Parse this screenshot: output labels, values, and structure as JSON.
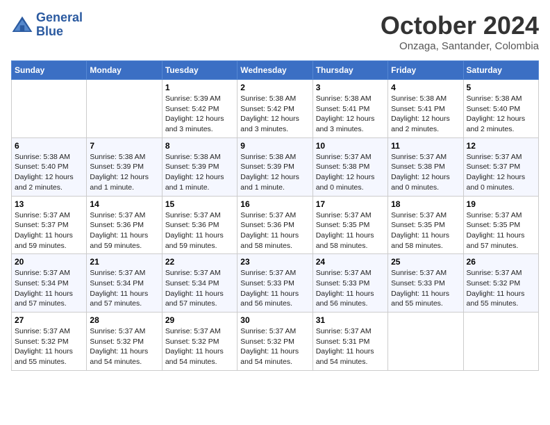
{
  "logo": {
    "line1": "General",
    "line2": "Blue"
  },
  "title": "October 2024",
  "location": "Onzaga, Santander, Colombia",
  "days_header": [
    "Sunday",
    "Monday",
    "Tuesday",
    "Wednesday",
    "Thursday",
    "Friday",
    "Saturday"
  ],
  "weeks": [
    [
      {
        "day": "",
        "info": ""
      },
      {
        "day": "",
        "info": ""
      },
      {
        "day": "1",
        "info": "Sunrise: 5:39 AM\nSunset: 5:42 PM\nDaylight: 12 hours and 3 minutes."
      },
      {
        "day": "2",
        "info": "Sunrise: 5:38 AM\nSunset: 5:42 PM\nDaylight: 12 hours and 3 minutes."
      },
      {
        "day": "3",
        "info": "Sunrise: 5:38 AM\nSunset: 5:41 PM\nDaylight: 12 hours and 3 minutes."
      },
      {
        "day": "4",
        "info": "Sunrise: 5:38 AM\nSunset: 5:41 PM\nDaylight: 12 hours and 2 minutes."
      },
      {
        "day": "5",
        "info": "Sunrise: 5:38 AM\nSunset: 5:40 PM\nDaylight: 12 hours and 2 minutes."
      }
    ],
    [
      {
        "day": "6",
        "info": "Sunrise: 5:38 AM\nSunset: 5:40 PM\nDaylight: 12 hours and 2 minutes."
      },
      {
        "day": "7",
        "info": "Sunrise: 5:38 AM\nSunset: 5:39 PM\nDaylight: 12 hours and 1 minute."
      },
      {
        "day": "8",
        "info": "Sunrise: 5:38 AM\nSunset: 5:39 PM\nDaylight: 12 hours and 1 minute."
      },
      {
        "day": "9",
        "info": "Sunrise: 5:38 AM\nSunset: 5:39 PM\nDaylight: 12 hours and 1 minute."
      },
      {
        "day": "10",
        "info": "Sunrise: 5:37 AM\nSunset: 5:38 PM\nDaylight: 12 hours and 0 minutes."
      },
      {
        "day": "11",
        "info": "Sunrise: 5:37 AM\nSunset: 5:38 PM\nDaylight: 12 hours and 0 minutes."
      },
      {
        "day": "12",
        "info": "Sunrise: 5:37 AM\nSunset: 5:37 PM\nDaylight: 12 hours and 0 minutes."
      }
    ],
    [
      {
        "day": "13",
        "info": "Sunrise: 5:37 AM\nSunset: 5:37 PM\nDaylight: 11 hours and 59 minutes."
      },
      {
        "day": "14",
        "info": "Sunrise: 5:37 AM\nSunset: 5:36 PM\nDaylight: 11 hours and 59 minutes."
      },
      {
        "day": "15",
        "info": "Sunrise: 5:37 AM\nSunset: 5:36 PM\nDaylight: 11 hours and 59 minutes."
      },
      {
        "day": "16",
        "info": "Sunrise: 5:37 AM\nSunset: 5:36 PM\nDaylight: 11 hours and 58 minutes."
      },
      {
        "day": "17",
        "info": "Sunrise: 5:37 AM\nSunset: 5:35 PM\nDaylight: 11 hours and 58 minutes."
      },
      {
        "day": "18",
        "info": "Sunrise: 5:37 AM\nSunset: 5:35 PM\nDaylight: 11 hours and 58 minutes."
      },
      {
        "day": "19",
        "info": "Sunrise: 5:37 AM\nSunset: 5:35 PM\nDaylight: 11 hours and 57 minutes."
      }
    ],
    [
      {
        "day": "20",
        "info": "Sunrise: 5:37 AM\nSunset: 5:34 PM\nDaylight: 11 hours and 57 minutes."
      },
      {
        "day": "21",
        "info": "Sunrise: 5:37 AM\nSunset: 5:34 PM\nDaylight: 11 hours and 57 minutes."
      },
      {
        "day": "22",
        "info": "Sunrise: 5:37 AM\nSunset: 5:34 PM\nDaylight: 11 hours and 57 minutes."
      },
      {
        "day": "23",
        "info": "Sunrise: 5:37 AM\nSunset: 5:33 PM\nDaylight: 11 hours and 56 minutes."
      },
      {
        "day": "24",
        "info": "Sunrise: 5:37 AM\nSunset: 5:33 PM\nDaylight: 11 hours and 56 minutes."
      },
      {
        "day": "25",
        "info": "Sunrise: 5:37 AM\nSunset: 5:33 PM\nDaylight: 11 hours and 55 minutes."
      },
      {
        "day": "26",
        "info": "Sunrise: 5:37 AM\nSunset: 5:32 PM\nDaylight: 11 hours and 55 minutes."
      }
    ],
    [
      {
        "day": "27",
        "info": "Sunrise: 5:37 AM\nSunset: 5:32 PM\nDaylight: 11 hours and 55 minutes."
      },
      {
        "day": "28",
        "info": "Sunrise: 5:37 AM\nSunset: 5:32 PM\nDaylight: 11 hours and 54 minutes."
      },
      {
        "day": "29",
        "info": "Sunrise: 5:37 AM\nSunset: 5:32 PM\nDaylight: 11 hours and 54 minutes."
      },
      {
        "day": "30",
        "info": "Sunrise: 5:37 AM\nSunset: 5:32 PM\nDaylight: 11 hours and 54 minutes."
      },
      {
        "day": "31",
        "info": "Sunrise: 5:37 AM\nSunset: 5:31 PM\nDaylight: 11 hours and 54 minutes."
      },
      {
        "day": "",
        "info": ""
      },
      {
        "day": "",
        "info": ""
      }
    ]
  ]
}
